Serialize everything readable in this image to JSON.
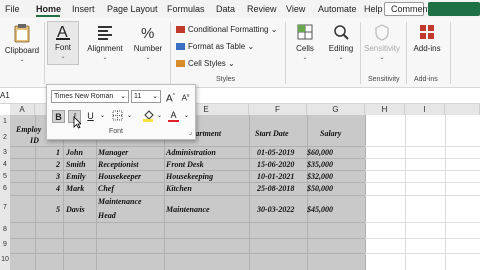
{
  "menu": {
    "tabs": [
      "File",
      "Home",
      "Insert",
      "Page Layout",
      "Formulas",
      "Data",
      "Review",
      "View",
      "Automate",
      "Help"
    ],
    "active": "Home",
    "comments": "Comments"
  },
  "ribbon": {
    "clipboard": "Clipboard",
    "font": "Font",
    "alignment": "Alignment",
    "number": "Number",
    "styles": {
      "conditional": "Conditional Formatting",
      "table": "Format as Table",
      "cell": "Cell Styles",
      "group": "Styles"
    },
    "cells": "Cells",
    "editing": "Editing",
    "sensitivity": "Sensitivity",
    "sensitivity_group": "Sensitivity",
    "addins": "Add-ins",
    "addins_group": "Add-ins"
  },
  "name_box": "A1",
  "columns": [
    "A",
    "B",
    "C",
    "D",
    "E",
    "F",
    "G",
    "H",
    "I"
  ],
  "rows": [
    "1",
    "2",
    "3",
    "4",
    "5",
    "6",
    "7",
    "8",
    "9",
    "10"
  ],
  "table": {
    "header": {
      "emp_line1": "Employ",
      "emp_line2": "ID",
      "department": "Department",
      "start_date": "Start Date",
      "salary": "Salary"
    },
    "records": [
      {
        "id": "1",
        "name": "John",
        "position": "Manager",
        "department": "Administration",
        "start": "01-05-2019",
        "salary": "$60,000"
      },
      {
        "id": "2",
        "name": "Smith",
        "position": "Receptionist",
        "department": "Front Desk",
        "start": "15-06-2020",
        "salary": "$35,000"
      },
      {
        "id": "3",
        "name": "Emily",
        "position": "Housekeeper",
        "department": "Housekeeping",
        "start": "10-01-2021",
        "salary": "$32,000"
      },
      {
        "id": "4",
        "name": "Mark",
        "position": "Chef",
        "department": "Kitchen",
        "start": "25-08-2018",
        "salary": "$50,000"
      },
      {
        "id": "5",
        "name": "Davis",
        "position_line1": "Maintenance",
        "position_line2": "Head",
        "department": "Maintenance",
        "start": "30-03-2022",
        "salary": "$45,000"
      }
    ]
  },
  "font_popup": {
    "font_name": "Times New Roman",
    "font_size": "11",
    "bold": "B",
    "italic": "I",
    "underline": "U",
    "font_color": "A",
    "font_color_hex": "#e0202a",
    "fill_color_hex": "#f6e23c",
    "grow": "A",
    "shrink": "A",
    "group_label": "Font"
  }
}
